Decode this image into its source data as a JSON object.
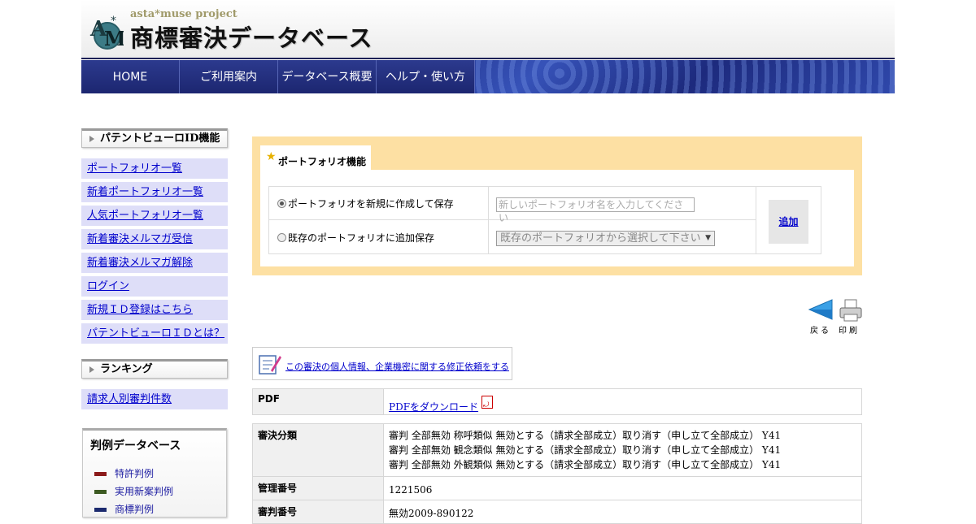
{
  "header": {
    "subtitle": "asta*muse project",
    "title": "商標審決データベース"
  },
  "nav": {
    "items": [
      "HOME",
      "ご利用案内",
      "データベース概要",
      "ヘルプ・使い方"
    ]
  },
  "sidebar": {
    "id_section": {
      "title": "パテントビューロID機能",
      "links": [
        "ポートフォリオ一覧",
        "新着ポートフォリオ一覧",
        "人気ポートフォリオ一覧",
        "新着審決メルマガ受信",
        "新着審決メルマガ解除",
        "ログイン",
        "新規ＩＤ登録はこちら",
        "パテントビューロＩＤとは？"
      ]
    },
    "ranking": {
      "title": "ランキング",
      "links": [
        "請求人別審判件数"
      ]
    },
    "database": {
      "title": "判例データベース",
      "items": [
        {
          "label": "特許判例",
          "color": "#8b1a1a"
        },
        {
          "label": "実用新案判例",
          "color": "#3d5a22"
        },
        {
          "label": "商標判例",
          "color": "#1c2a6e"
        }
      ]
    }
  },
  "portfolio": {
    "tab_label": "ポートフォリオ機能",
    "option_new": "ポートフォリオを新規に作成して保存",
    "option_existing": "既存のポートフォリオに追加保存",
    "new_name_placeholder": "新しいポートフォリオ名を入力してください",
    "existing_select": "既存のポートフォリオから選択して下さい",
    "add_button": "追加"
  },
  "tools": {
    "back": "戻る",
    "print": "印刷"
  },
  "correction_link": "この審決の個人情報、企業機密に関する修正依頼をする",
  "details": {
    "pdf_label": "PDF",
    "pdf_link": "PDFをダウンロード",
    "category_label": "審決分類",
    "categories": [
      "審判 全部無効 称呼類似 無効とする（請求全部成立）取り消す（申し立て全部成立） Y41",
      "審判 全部無効 観念類似 無効とする（請求全部成立）取り消す（申し立て全部成立） Y41",
      "審判 全部無効 外観類似 無効とする（請求全部成立）取り消す（申し立て全部成立） Y41"
    ],
    "management_label": "管理番号",
    "management_number": "1221506",
    "trial_label": "審判番号",
    "trial_number": "無効2009-890122"
  },
  "colors": {
    "nav_bg": "#1c2670",
    "sidebar_link_bg": "#dedef8",
    "portfolio_bg": "#fde0a3",
    "link": "#0000cc"
  }
}
